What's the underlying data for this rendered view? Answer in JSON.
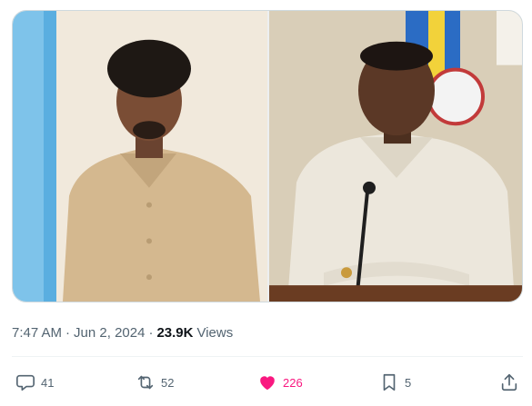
{
  "tweet": {
    "time": "7:47 AM",
    "separator": "·",
    "date": "Jun 2, 2024",
    "views_count": "23.9K",
    "views_label": "Views"
  },
  "actions": {
    "replies": "41",
    "reposts": "52",
    "likes": "226",
    "bookmarks": "5"
  },
  "colors": {
    "like_active": "#f91880",
    "muted_text": "#536471",
    "border": "#cfd9de"
  },
  "icons": [
    "reply-icon",
    "repost-icon",
    "heart-icon",
    "bookmark-icon",
    "share-icon"
  ]
}
